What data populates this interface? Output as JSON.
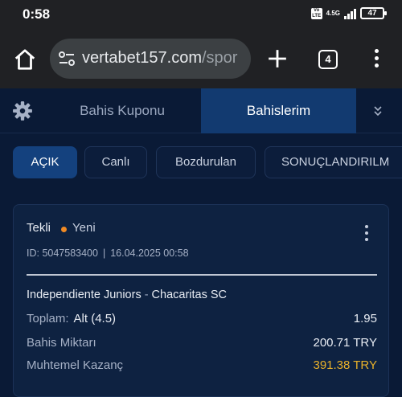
{
  "status_bar": {
    "time": "0:58",
    "volte": "Vo LTE",
    "network": "4.5G",
    "battery": "47"
  },
  "browser": {
    "url_main": "vertabet157.com",
    "url_path": "/spor",
    "tab_count": "4"
  },
  "tabs": [
    {
      "label": "Bahis Kuponu",
      "active": false
    },
    {
      "label": "Bahislerim",
      "active": true
    }
  ],
  "filters": [
    {
      "label": "AÇIK",
      "active": true
    },
    {
      "label": "Canlı",
      "active": false
    },
    {
      "label": "Bozdurulan",
      "active": false
    },
    {
      "label": "SONUÇLANDIRILM",
      "active": false
    }
  ],
  "bet": {
    "type": "Tekli",
    "status": "Yeni",
    "id_text": "ID: 5047583400",
    "datetime": "16.04.2025 00:58",
    "home": "Independiente Juniors",
    "away": "Chacaritas SC",
    "market_label": "Toplam:",
    "selection": "Alt (4.5)",
    "odds": "1.95",
    "stake_label": "Bahis Miktarı",
    "stake_value": "200.71 TRY",
    "win_label": "Muhtemel Kazanç",
    "win_value": "391.38 TRY"
  },
  "colors": {
    "background": "#0a1a36",
    "active_tab": "#123a70",
    "active_filter": "#14417e",
    "status_dot": "#f08a24",
    "potential_win": "#e9b12a"
  }
}
